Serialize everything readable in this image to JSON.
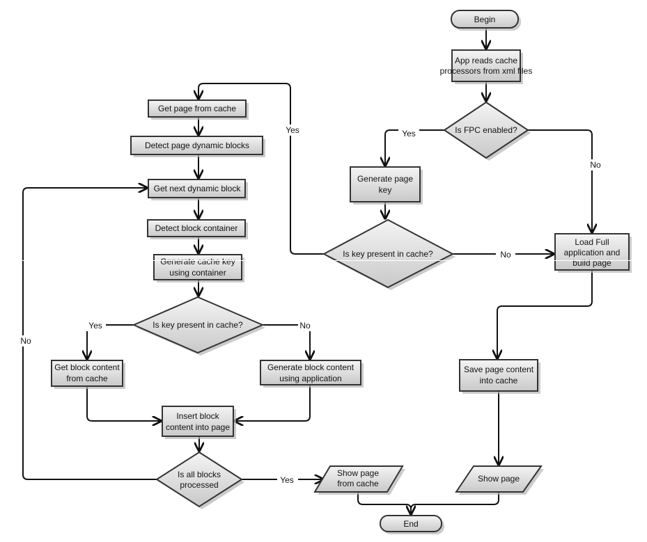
{
  "nodes": {
    "begin": "Begin",
    "app_reads": [
      "App reads cache",
      "processors from xml files"
    ],
    "fpc_enabled": "Is FPC enabled?",
    "gen_page_key": [
      "Generate page",
      "key"
    ],
    "key_present_page": "Is key present in cache?",
    "load_full": [
      "Load Full",
      "application and",
      "build page"
    ],
    "get_page": "Get page from cache",
    "detect_dynamic": "Detect page dynamic blocks",
    "get_next": "Get next dynamic block",
    "detect_container": "Detect block container",
    "gen_cache_key": [
      "Generate cache key",
      "using container"
    ],
    "key_present_block": "Is key present in cache?",
    "get_block": [
      "Get block content",
      "from cache"
    ],
    "gen_block": [
      "Generate block content",
      "using application"
    ],
    "insert_block": [
      "Insert block",
      "content into page"
    ],
    "all_blocks": [
      "Is all blocks",
      "processed"
    ],
    "show_from_cache": [
      "Show page",
      "from cache"
    ],
    "save_page": [
      "Save page content",
      "into cache"
    ],
    "show_page": "Show page",
    "end": "End"
  },
  "edges": {
    "fpc_yes": "Yes",
    "fpc_no": "No",
    "page_key_yes": "Yes",
    "page_key_no": "No",
    "block_key_yes": "Yes",
    "block_key_no": "No",
    "all_blocks_no": "No",
    "all_blocks_yes": "Yes"
  },
  "colors": {
    "shape_fill_top": "#f4f4f4",
    "shape_fill_bottom": "#c9c9c9",
    "stroke": "#333333"
  }
}
